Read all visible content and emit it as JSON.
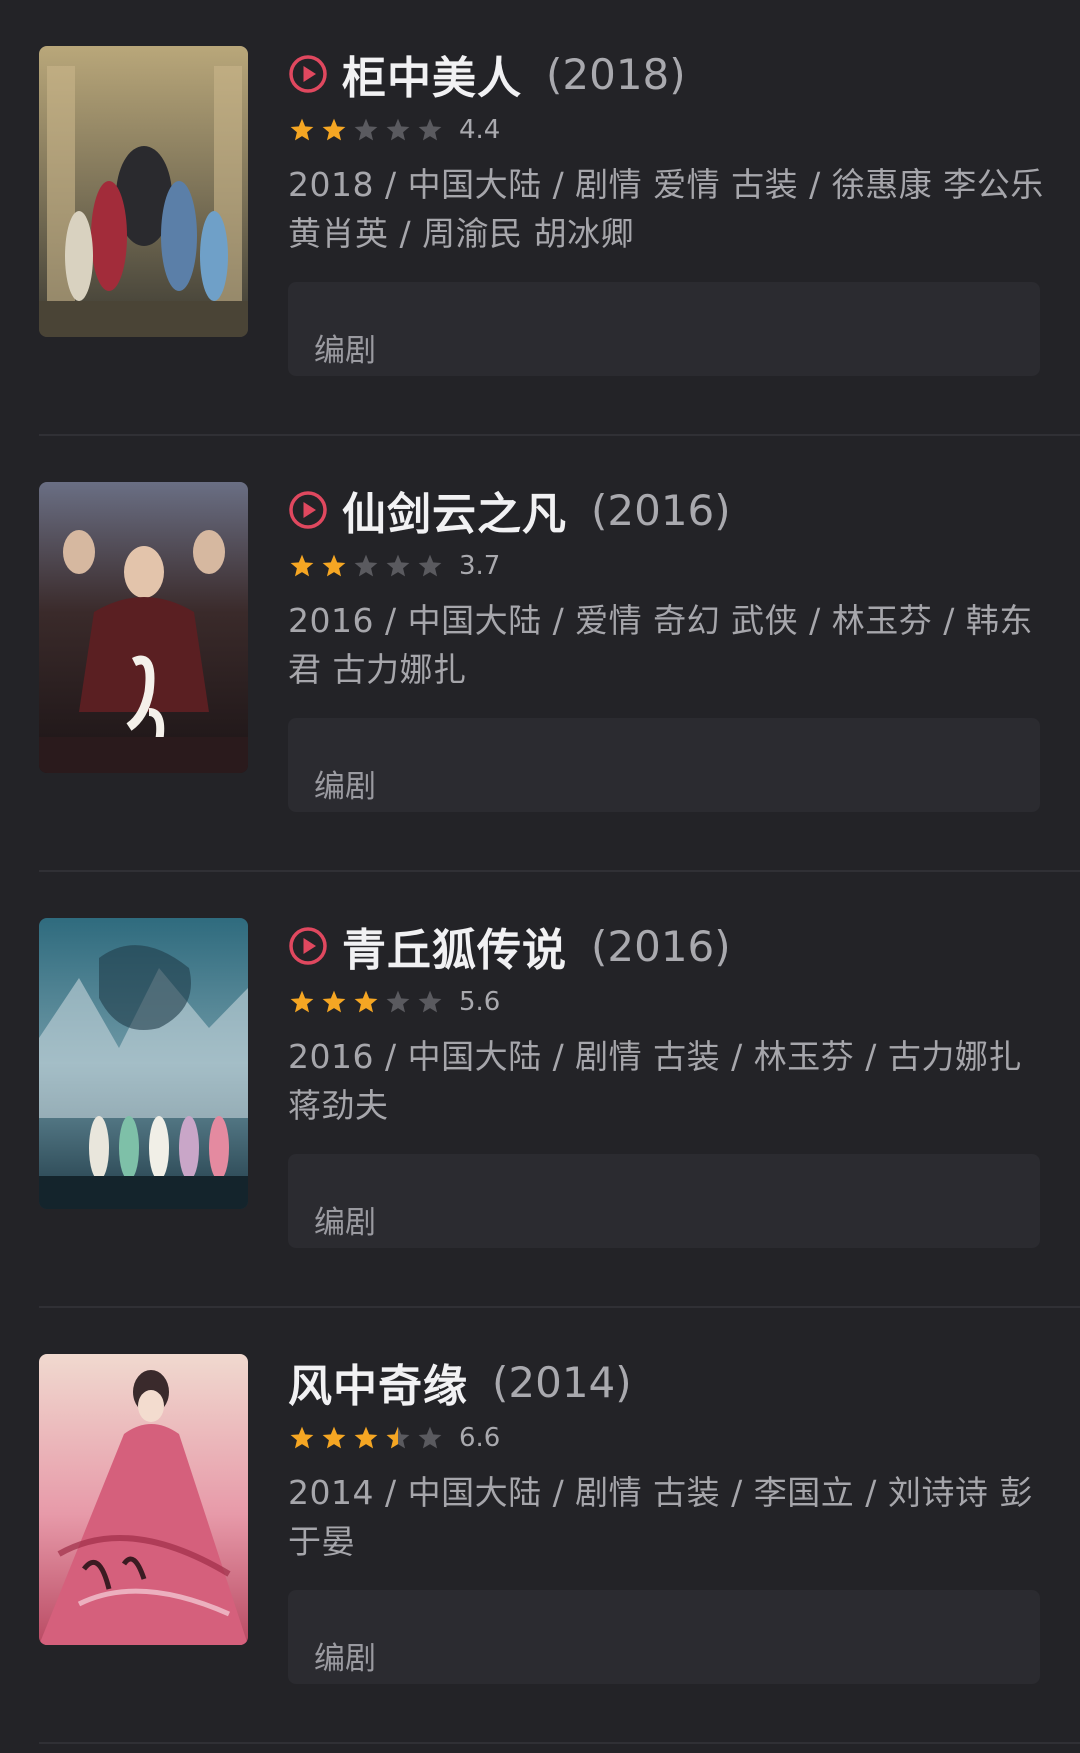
{
  "colors": {
    "background": "#232327",
    "play_icon": "#e0485f",
    "star_filled": "#f5a623",
    "star_empty": "#5a5a5f"
  },
  "items": [
    {
      "title": "柜中美人",
      "year": "(2018)",
      "has_play": true,
      "stars": 2,
      "score": "4.4",
      "meta": "2018 / 中国大陆 / 剧情 爱情 古装 / 徐惠康 李公乐 黄肖英 / 周渝民 胡冰卿",
      "credit_label": "编剧",
      "poster_icon": "drama-poster-icon"
    },
    {
      "title": "仙剑云之凡",
      "year": "(2016)",
      "has_play": true,
      "stars": 2,
      "score": "3.7",
      "meta": "2016 / 中国大陆 / 爱情 奇幻 武侠 / 林玉芬 / 韩东君 古力娜扎",
      "credit_label": "编剧",
      "poster_icon": "drama-poster-icon"
    },
    {
      "title": "青丘狐传说",
      "year": "(2016)",
      "has_play": true,
      "stars": 3,
      "score": "5.6",
      "meta": "2016 / 中国大陆 / 剧情 古装 / 林玉芬 / 古力娜扎 蒋劲夫",
      "credit_label": "编剧",
      "poster_icon": "drama-poster-icon"
    },
    {
      "title": "风中奇缘",
      "year": "(2014)",
      "has_play": false,
      "stars": 3.5,
      "score": "6.6",
      "meta": "2014 / 中国大陆 / 剧情 古装 / 李国立 / 刘诗诗 彭于晏",
      "credit_label": "编剧",
      "poster_icon": "drama-poster-icon"
    }
  ]
}
